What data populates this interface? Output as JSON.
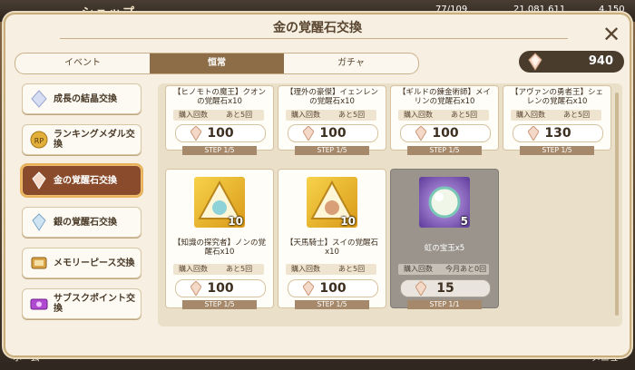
{
  "background": {
    "shop_label": "ショップ",
    "stamina": "77/109",
    "gold": "21,081,611",
    "premium": "4,150",
    "home_label": "ホーム",
    "menu_label": "メニュー"
  },
  "modal": {
    "title": "金の覚醒石交換",
    "close_icon": "close-icon"
  },
  "tabs": [
    {
      "label": "イベント",
      "active": false
    },
    {
      "label": "恒常",
      "active": true
    },
    {
      "label": "ガチャ",
      "active": false
    }
  ],
  "currency": {
    "value": "940",
    "icon": "gold-awakening-stone-icon"
  },
  "sidebar": {
    "items": [
      {
        "label": "成長の結晶交換",
        "icon": "growth-crystal-icon",
        "active": false
      },
      {
        "label": "ランキングメダル交換",
        "icon": "rp-medal-icon",
        "active": false
      },
      {
        "label": "金の覚醒石交換",
        "icon": "gold-awakening-stone-icon",
        "active": true
      },
      {
        "label": "銀の覚醒石交換",
        "icon": "silver-awakening-stone-icon",
        "active": false
      },
      {
        "label": "メモリーピース交換",
        "icon": "memory-piece-icon",
        "active": false
      },
      {
        "label": "サブスクポイント交換",
        "icon": "subscription-ticket-icon",
        "active": false
      }
    ]
  },
  "cards_top": [
    {
      "name": "【ヒノモトの魔王】クオンの覚醒石x10",
      "count_label": "購入回数",
      "count_value": "あと5回",
      "price": "100",
      "step": "STEP 1/5"
    },
    {
      "name": "【理外の豪傑】イェンレンの覚醒石x10",
      "count_label": "購入回数",
      "count_value": "あと5回",
      "price": "100",
      "step": "STEP 1/5"
    },
    {
      "name": "【ギルドの錬金術師】メイリンの覚醒石x10",
      "count_label": "購入回数",
      "count_value": "あと5回",
      "price": "100",
      "step": "STEP 1/5"
    },
    {
      "name": "【アヴァンの勇者王】シェレンの覚醒石x10",
      "count_label": "購入回数",
      "count_value": "あと5回",
      "price": "130",
      "step": "STEP 1/5"
    }
  ],
  "cards_bottom": [
    {
      "name": "【知識の探究者】ノンの覚醒石x10",
      "qty": "10",
      "count_label": "購入回数",
      "count_value": "あと5回",
      "price": "100",
      "step": "STEP 1/5",
      "icon": "gold-awakening-stone-portrait-icon"
    },
    {
      "name": "【天馬騎士】スイの覚醒石x10",
      "qty": "10",
      "count_label": "購入回数",
      "count_value": "あと5回",
      "price": "100",
      "step": "STEP 1/5",
      "icon": "gold-awakening-stone-portrait-icon"
    },
    {
      "name": "虹の宝玉x5",
      "qty": "5",
      "count_label": "購入回数",
      "count_value": "今月あと0回",
      "price": "15",
      "step": "STEP 1/1",
      "icon": "rainbow-orb-icon"
    }
  ]
}
